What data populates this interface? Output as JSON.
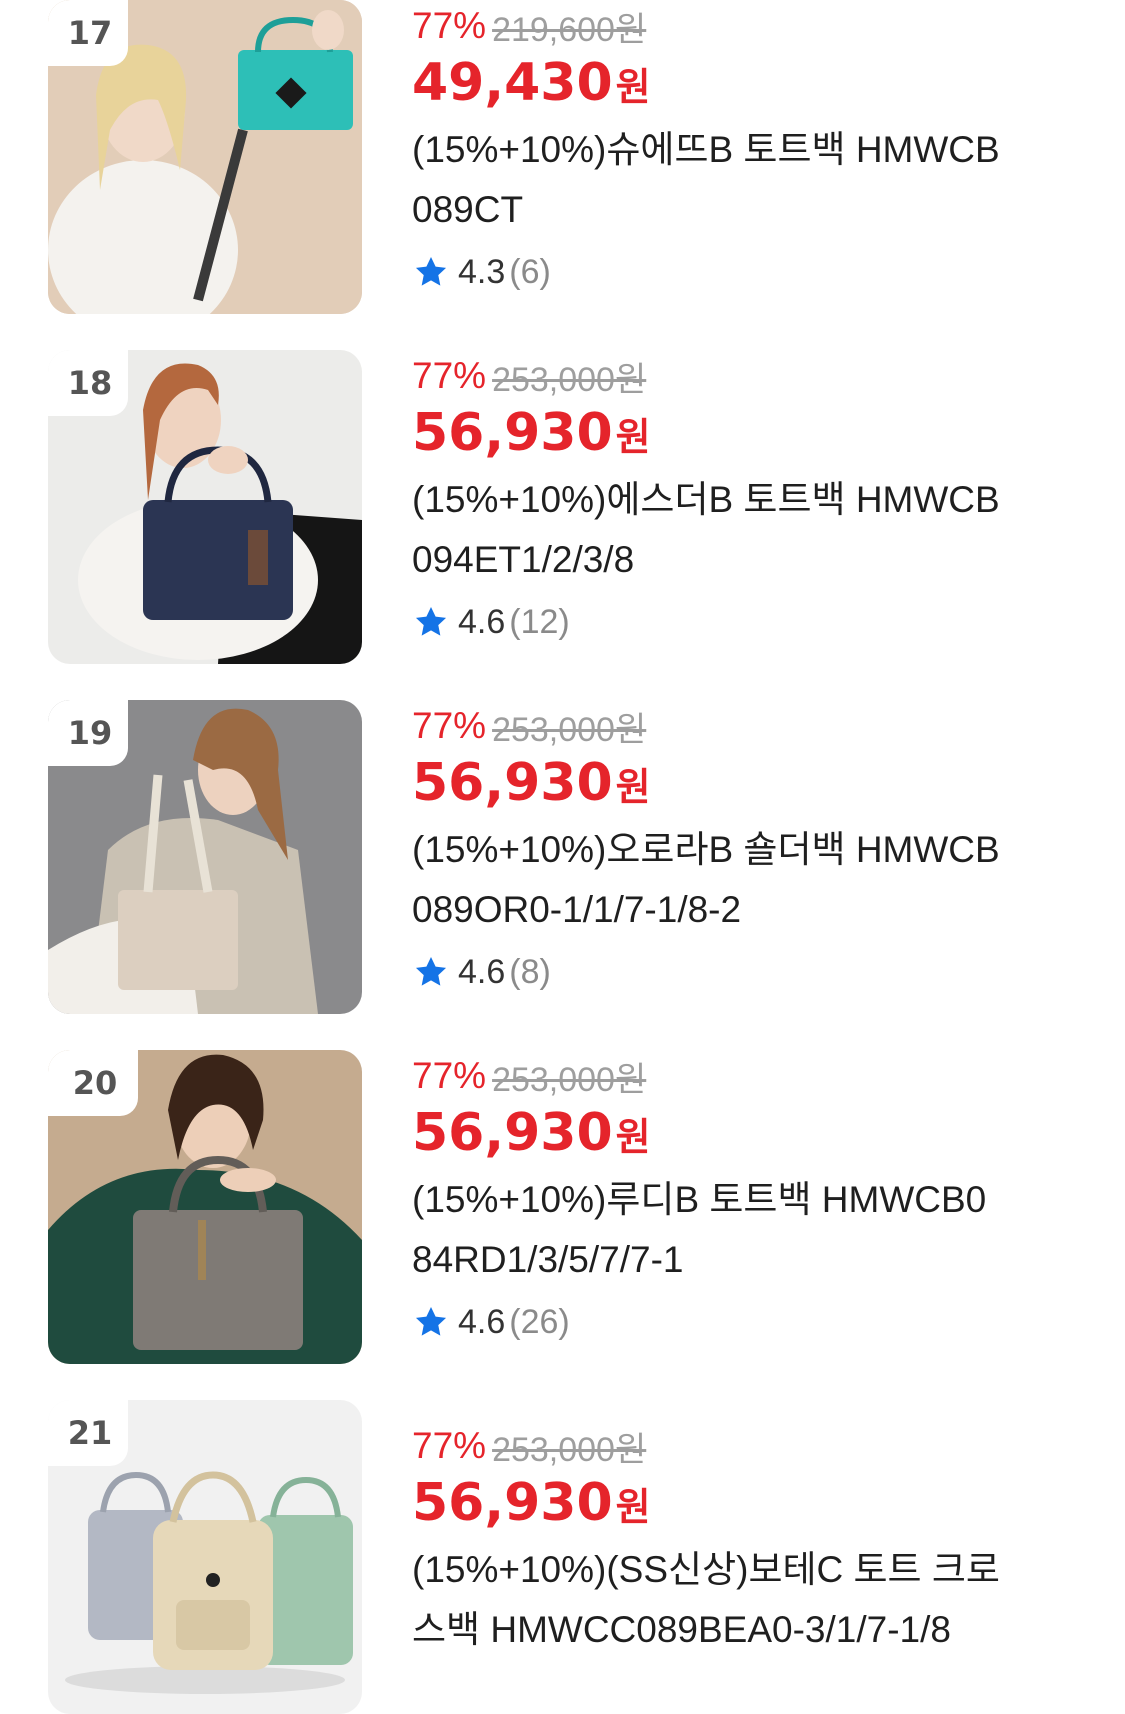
{
  "colors": {
    "discount": "#e5242b",
    "sale_price": "#e5242b",
    "original_price": "#9e9e9e",
    "star": "#1473e6"
  },
  "items": [
    {
      "rank": "17",
      "discount": "77%",
      "original_price": "219,600원",
      "sale_price": "49,430",
      "currency": "원",
      "name": "(15%+10%)슈에뜨B 토트백 HMWCB\n089CT",
      "rating": "4.3",
      "review_count": "(6)",
      "image": "model with teal handbag"
    },
    {
      "rank": "18",
      "discount": "77%",
      "original_price": "253,000원",
      "sale_price": "56,930",
      "currency": "원",
      "name": "(15%+10%)에스더B 토트백 HMWCB\n094ET1/2/3/8",
      "rating": "4.6",
      "review_count": "(12)",
      "image": "model with navy tote bag"
    },
    {
      "rank": "19",
      "discount": "77%",
      "original_price": "253,000원",
      "sale_price": "56,930",
      "currency": "원",
      "name": "(15%+10%)오로라B 숄더백 HMWCB\n089OR0-1/1/7-1/8-2",
      "rating": "4.6",
      "review_count": "(8)",
      "image": "model with beige shoulder bag"
    },
    {
      "rank": "20",
      "discount": "77%",
      "original_price": "253,000원",
      "sale_price": "56,930",
      "currency": "원",
      "name": "(15%+10%)루디B 토트백 HMWCB0\n84RD1/3/5/7/7-1",
      "rating": "4.6",
      "review_count": "(26)",
      "image": "model with grey tote bag"
    },
    {
      "rank": "21",
      "discount": "77%",
      "original_price": "253,000원",
      "sale_price": "56,930",
      "currency": "원",
      "name": "(15%+10%)(SS신상)보테C 토트 크로\n스백 HMWCC089BEA0-3/1/7-1/8",
      "rating": "",
      "review_count": "",
      "image": "three nylon tote bags"
    }
  ]
}
